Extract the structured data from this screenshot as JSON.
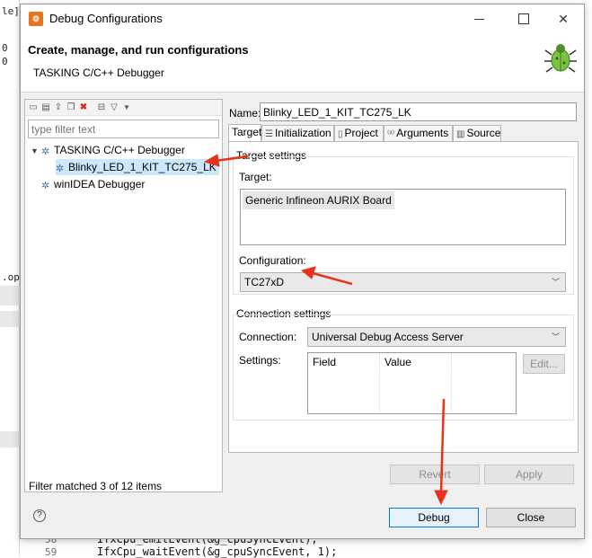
{
  "background": {
    "left_fragments": [
      "le]",
      "0",
      "0",
      ".opt"
    ],
    "code_lines": [
      {
        "number": "58",
        "text": "IfxCpu_emitEvent(&g_cpuSyncEvent);"
      },
      {
        "number": "59",
        "text": "IfxCpu_waitEvent(&g_cpuSyncEvent, 1);"
      }
    ]
  },
  "dialog": {
    "title": "Debug Configurations",
    "close_glyph": "✕",
    "header_title": "Create, manage, and run configurations",
    "header_subtitle": "TASKING C/C++ Debugger"
  },
  "left_pane": {
    "filter_placeholder": "type filter text",
    "tree": [
      {
        "label": "TASKING C/C++ Debugger",
        "level": 0,
        "expanded": true
      },
      {
        "label": "Blinky_LED_1_KIT_TC275_LK",
        "level": 1,
        "selected": true
      },
      {
        "label": "winIDEA Debugger",
        "level": 0
      }
    ],
    "status": "Filter matched 3 of 12 items"
  },
  "right_pane": {
    "name_label": "Name:",
    "name_value": "Blinky_LED_1_KIT_TC275_LK",
    "tabs": [
      {
        "label": "Target",
        "icon": "target-icon",
        "active": true
      },
      {
        "label": "Initialization",
        "icon": "list-icon"
      },
      {
        "label": "Project",
        "icon": "page-icon"
      },
      {
        "label": "Arguments",
        "icon": "arguments-icon"
      },
      {
        "label": "Source",
        "icon": "source-icon"
      }
    ],
    "target_group": "Target settings",
    "target_label": "Target:",
    "target_value": "Generic Infineon AURIX Board",
    "configuration_label": "Configuration:",
    "configuration_value": "TC27xD",
    "connection_group": "Connection settings",
    "connection_label": "Connection:",
    "connection_value": "Universal Debug Access Server",
    "settings_label": "Settings:",
    "settings_columns": [
      "Field",
      "Value"
    ],
    "edit_button": "Edit...",
    "revert_button": "Revert",
    "apply_button": "Apply"
  },
  "footer": {
    "help_glyph": "?",
    "debug_button": "Debug",
    "close_button": "Close"
  },
  "colors": {
    "annotation_arrow": "#e8321e",
    "selection": "#cce8ff",
    "default_button_border": "#0078d7"
  }
}
